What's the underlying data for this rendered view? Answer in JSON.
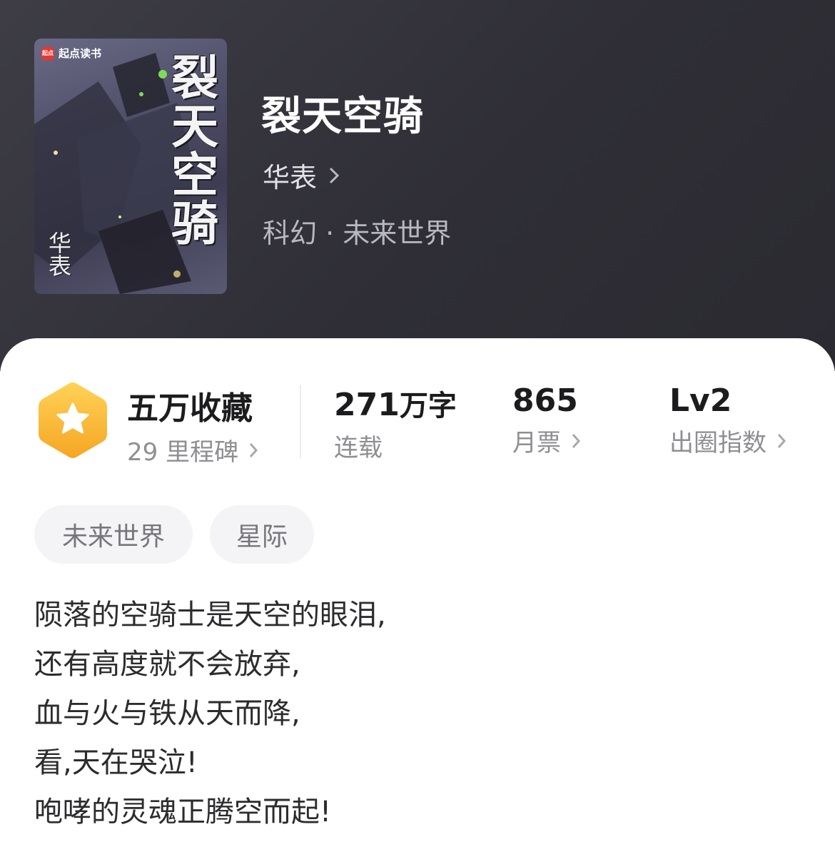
{
  "book": {
    "title": "裂天空骑",
    "author": "华表",
    "genre": "科幻 · 未来世界"
  },
  "cover": {
    "brand": "起点读书",
    "logo_text": "起点",
    "title": "裂天空骑",
    "author": "华表"
  },
  "stats": {
    "collection": {
      "value": "五万收藏",
      "sub": "29 里程碑",
      "icon": "star-hexagon-icon"
    },
    "words": {
      "value": "271",
      "unit": "万字",
      "sub": "连载"
    },
    "monthly_tickets": {
      "value": "865",
      "sub": "月票"
    },
    "influence": {
      "value": "Lv2",
      "sub": "出圈指数"
    }
  },
  "tags": [
    "未来世界",
    "星际"
  ],
  "description": [
    "陨落的空骑士是天空的眼泪,",
    "还有高度就不会放弃,",
    "血与火与铁从天而降,",
    "看,天在哭泣!",
    "咆哮的灵魂正腾空而起!"
  ],
  "colors": {
    "header_bg": "#34333b",
    "badge_gradient_top": "#ffd257",
    "badge_gradient_bottom": "#f5a623",
    "text_primary": "#1c1c1e",
    "text_secondary": "#8e8e93"
  }
}
